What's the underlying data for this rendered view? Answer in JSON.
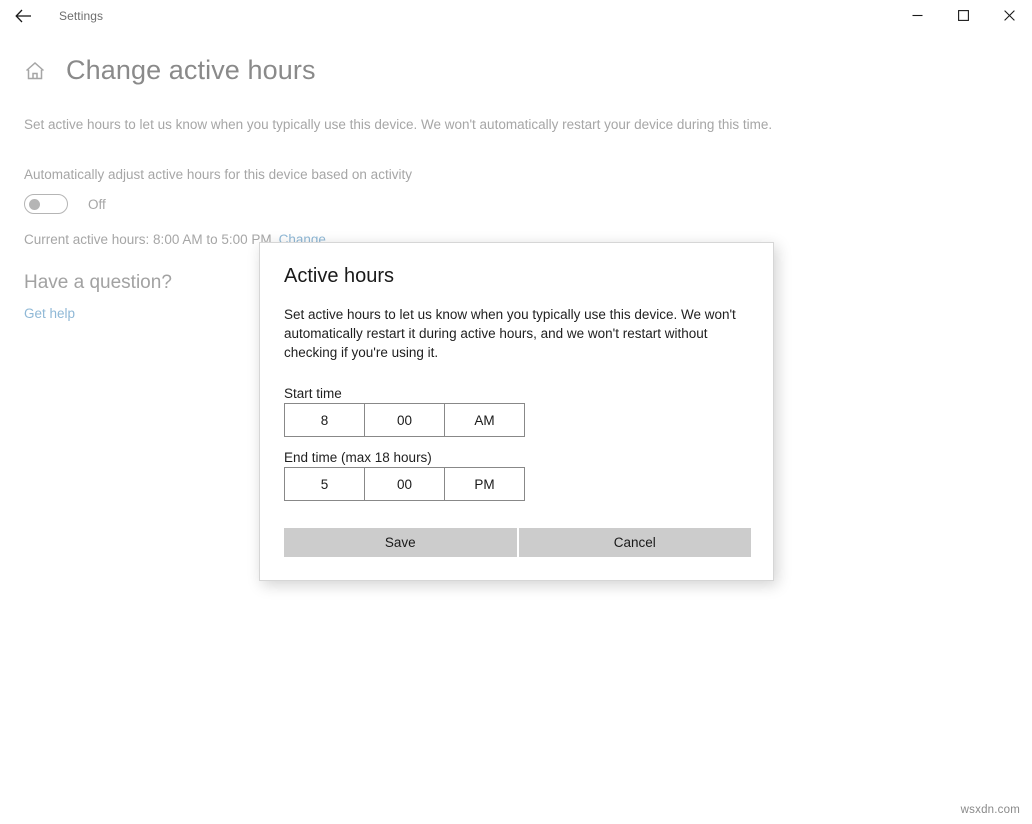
{
  "window": {
    "title": "Settings",
    "back_icon": "back-arrow-icon",
    "minimize_label": "─",
    "maximize_label": "□",
    "close_label": "✕"
  },
  "page": {
    "home_icon": "home-icon",
    "title": "Change active hours",
    "description": "Set active hours to let us know when you typically use this device. We won't automatically restart your device during this time.",
    "auto_adjust_label": "Automatically adjust active hours for this device based on activity",
    "toggle_state": "Off",
    "toggle_on": false,
    "current_hours_text": "Current active hours: 8:00 AM to 5:00 PM",
    "change_link": "Change",
    "question_heading": "Have a question?",
    "get_help_link": "Get help"
  },
  "dialog": {
    "title": "Active hours",
    "body": "Set active hours to let us know when you typically use this device. We won't automatically restart it during active hours, and we won't restart without checking if you're using it.",
    "start_label": "Start time",
    "end_label": "End time (max 18 hours)",
    "start_time": {
      "hour": "8",
      "minute": "00",
      "meridiem": "AM"
    },
    "end_time": {
      "hour": "5",
      "minute": "00",
      "meridiem": "PM"
    },
    "save_label": "Save",
    "cancel_label": "Cancel"
  },
  "watermark": "wsxdn.com",
  "colors": {
    "link": "#8fb8d6",
    "muted_text": "#a6a6a6",
    "dialog_text": "#1f1f1f",
    "button_bg": "#cccccc",
    "picker_border": "#888888"
  }
}
